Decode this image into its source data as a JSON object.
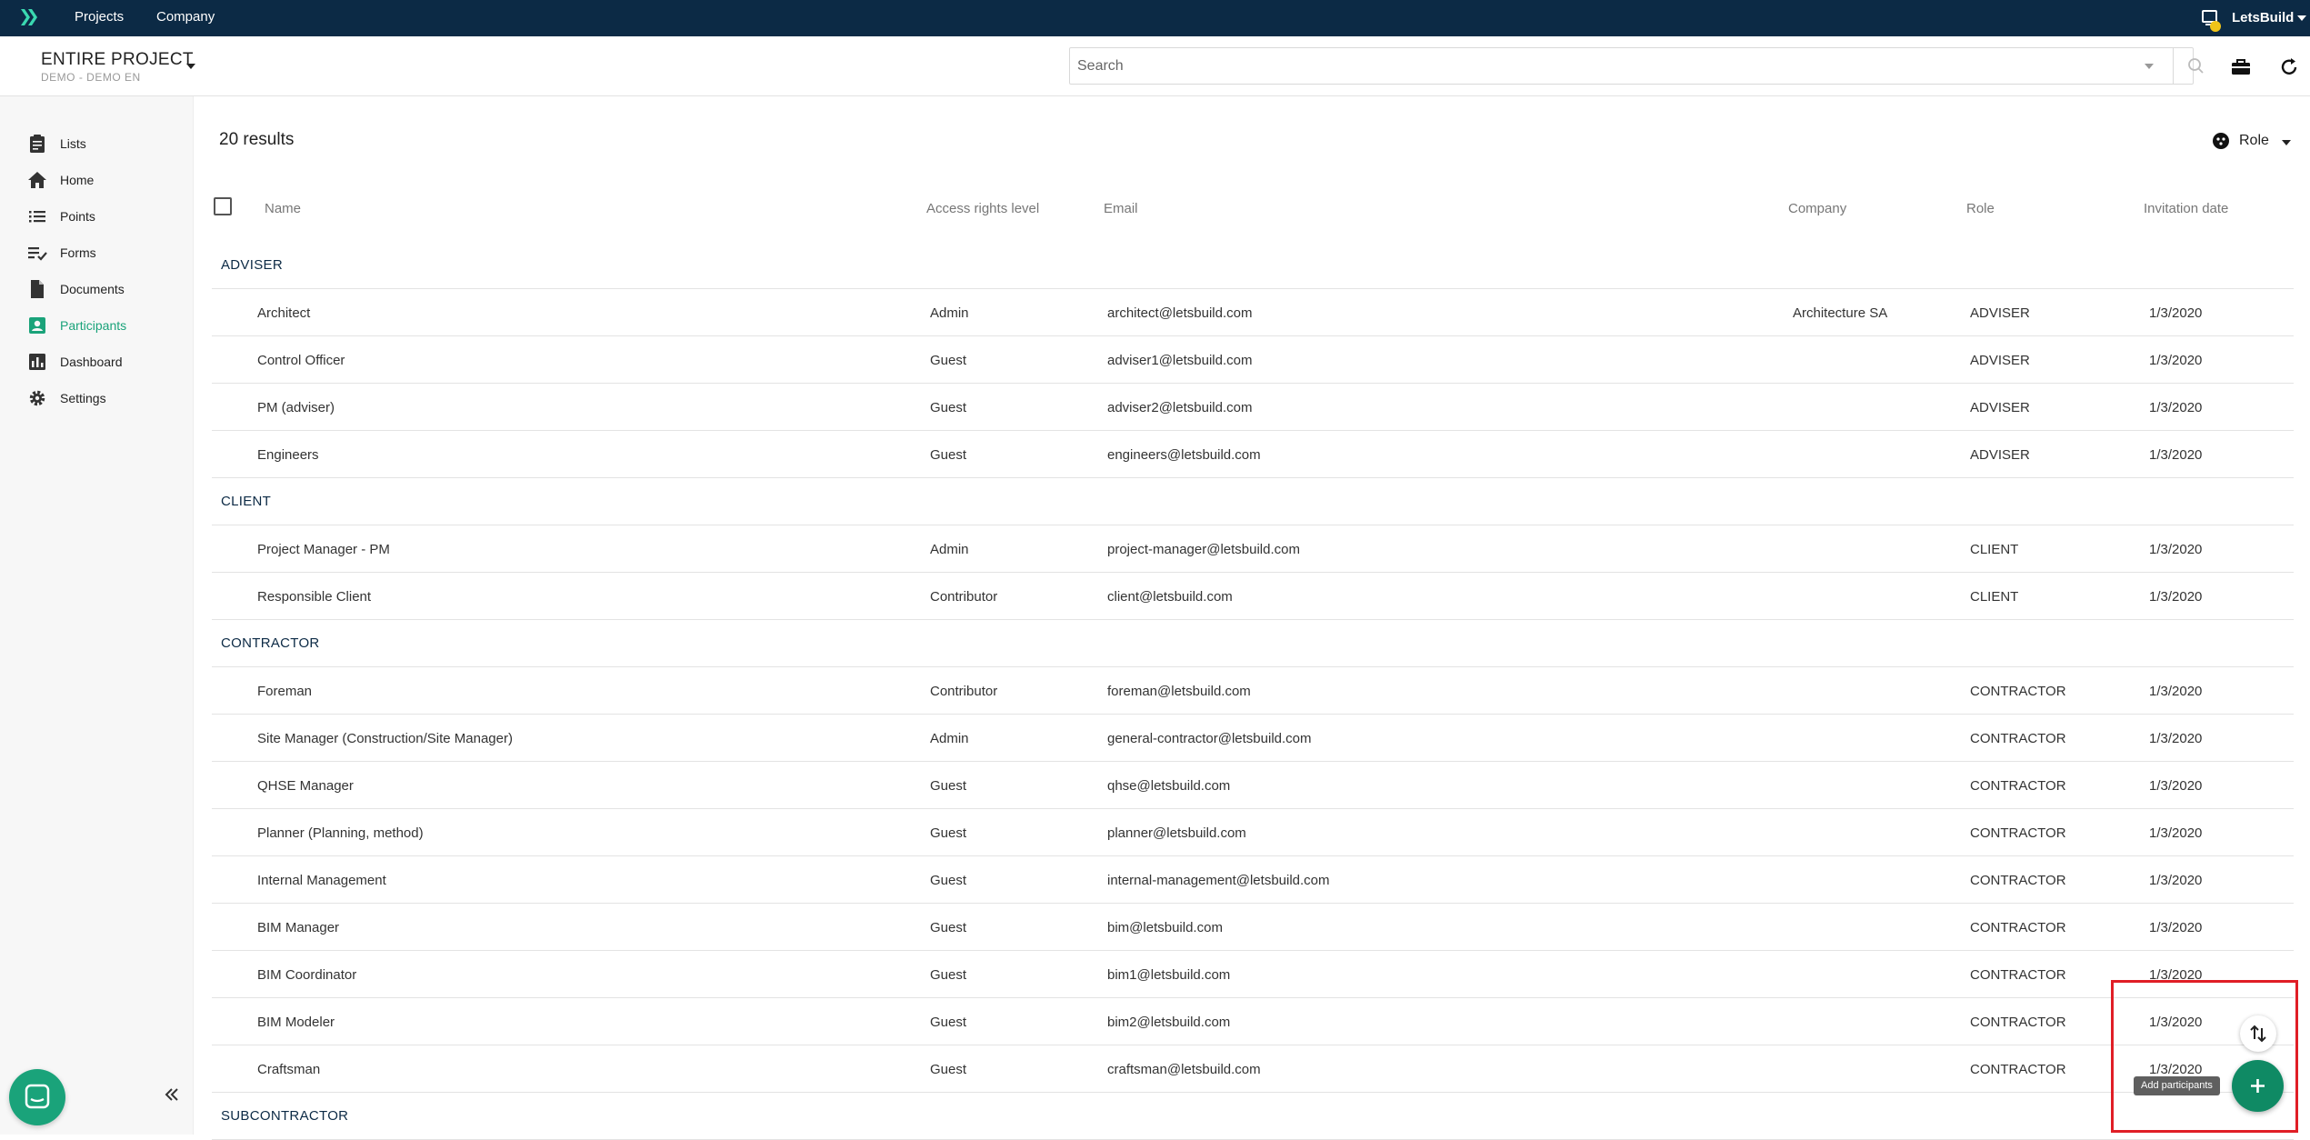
{
  "topnav": {
    "links": [
      "Projects",
      "Company"
    ],
    "user": "LetsBuild"
  },
  "project": {
    "title": "ENTIRE PROJECT",
    "subtitle": "DEMO - DEMO EN"
  },
  "search": {
    "placeholder": "Search"
  },
  "sidebar": {
    "items": [
      {
        "label": "Lists",
        "icon": "clipboard-icon"
      },
      {
        "label": "Home",
        "icon": "home-icon"
      },
      {
        "label": "Points",
        "icon": "list-icon"
      },
      {
        "label": "Forms",
        "icon": "checklist-icon"
      },
      {
        "label": "Documents",
        "icon": "document-icon"
      },
      {
        "label": "Participants",
        "icon": "participants-icon",
        "active": true
      },
      {
        "label": "Dashboard",
        "icon": "bar-chart-icon"
      },
      {
        "label": "Settings",
        "icon": "gear-icon"
      }
    ]
  },
  "main": {
    "results": "20 results",
    "role_filter": "Role",
    "columns": {
      "name": "Name",
      "access": "Access rights level",
      "email": "Email",
      "company": "Company",
      "role": "Role",
      "date": "Invitation date"
    },
    "groups": [
      {
        "name": "ADVISER",
        "rows": [
          {
            "name": "Architect",
            "access": "Admin",
            "email": "architect@letsbuild.com",
            "company": "Architecture SA",
            "role": "ADVISER",
            "date": "1/3/2020"
          },
          {
            "name": "Control Officer",
            "access": "Guest",
            "email": "adviser1@letsbuild.com",
            "company": "",
            "role": "ADVISER",
            "date": "1/3/2020"
          },
          {
            "name": "PM (adviser)",
            "access": "Guest",
            "email": "adviser2@letsbuild.com",
            "company": "",
            "role": "ADVISER",
            "date": "1/3/2020"
          },
          {
            "name": "Engineers",
            "access": "Guest",
            "email": "engineers@letsbuild.com",
            "company": "",
            "role": "ADVISER",
            "date": "1/3/2020"
          }
        ]
      },
      {
        "name": "CLIENT",
        "rows": [
          {
            "name": "Project Manager - PM",
            "access": "Admin",
            "email": "project-manager@letsbuild.com",
            "company": "",
            "role": "CLIENT",
            "date": "1/3/2020"
          },
          {
            "name": "Responsible Client",
            "access": "Contributor",
            "email": "client@letsbuild.com",
            "company": "",
            "role": "CLIENT",
            "date": "1/3/2020"
          }
        ]
      },
      {
        "name": "CONTRACTOR",
        "rows": [
          {
            "name": "Foreman",
            "access": "Contributor",
            "email": "foreman@letsbuild.com",
            "company": "",
            "role": "CONTRACTOR",
            "date": "1/3/2020"
          },
          {
            "name": "Site Manager (Construction/Site Manager)",
            "access": "Admin",
            "email": "general-contractor@letsbuild.com",
            "company": "",
            "role": "CONTRACTOR",
            "date": "1/3/2020"
          },
          {
            "name": "QHSE Manager",
            "access": "Guest",
            "email": "qhse@letsbuild.com",
            "company": "",
            "role": "CONTRACTOR",
            "date": "1/3/2020"
          },
          {
            "name": "Planner (Planning, method)",
            "access": "Guest",
            "email": "planner@letsbuild.com",
            "company": "",
            "role": "CONTRACTOR",
            "date": "1/3/2020"
          },
          {
            "name": "Internal Management",
            "access": "Guest",
            "email": "internal-management@letsbuild.com",
            "company": "",
            "role": "CONTRACTOR",
            "date": "1/3/2020"
          },
          {
            "name": "BIM Manager",
            "access": "Guest",
            "email": "bim@letsbuild.com",
            "company": "",
            "role": "CONTRACTOR",
            "date": "1/3/2020"
          },
          {
            "name": "BIM Coordinator",
            "access": "Guest",
            "email": "bim1@letsbuild.com",
            "company": "",
            "role": "CONTRACTOR",
            "date": "1/3/2020"
          },
          {
            "name": "BIM Modeler",
            "access": "Guest",
            "email": "bim2@letsbuild.com",
            "company": "",
            "role": "CONTRACTOR",
            "date": "1/3/2020"
          },
          {
            "name": "Craftsman",
            "access": "Guest",
            "email": "craftsman@letsbuild.com",
            "company": "",
            "role": "CONTRACTOR",
            "date": "1/3/2020"
          }
        ]
      },
      {
        "name": "SUBCONTRACTOR",
        "rows": []
      }
    ]
  },
  "fab": {
    "tooltip": "Add participants"
  },
  "colors": {
    "topbar": "#0c2a45",
    "accent": "#1aa37a",
    "fab": "#0f8a64",
    "highlight": "#e01e26"
  }
}
